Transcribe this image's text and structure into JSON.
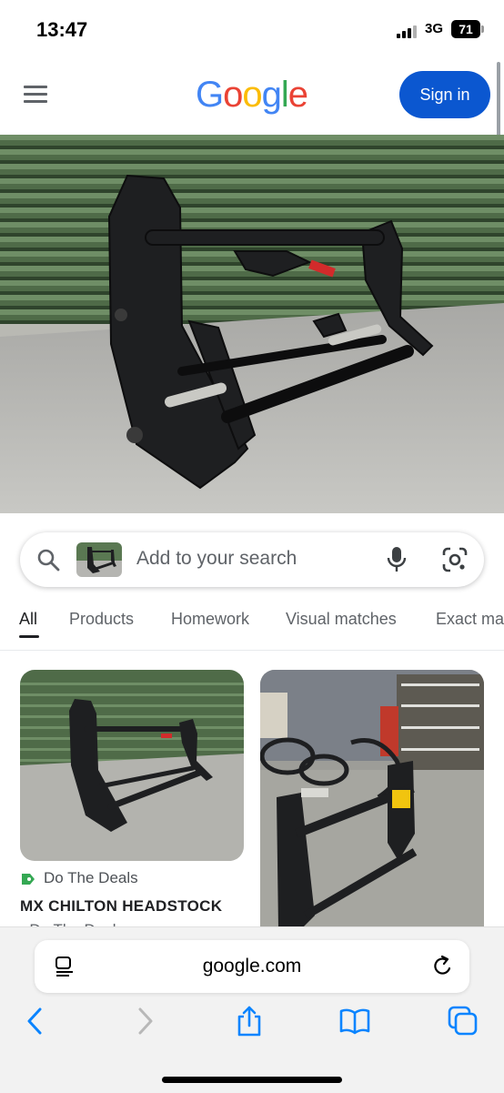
{
  "status_bar": {
    "time": "13:47",
    "network": "3G",
    "battery": "71"
  },
  "header": {
    "logo_letters": [
      {
        "char": "G",
        "color": "#4285F4"
      },
      {
        "char": "o",
        "color": "#EA4335"
      },
      {
        "char": "o",
        "color": "#FBBC05"
      },
      {
        "char": "g",
        "color": "#4285F4"
      },
      {
        "char": "l",
        "color": "#34A853"
      },
      {
        "char": "e",
        "color": "#EA4335"
      }
    ],
    "signin_label": "Sign in"
  },
  "search": {
    "placeholder": "Add to your search"
  },
  "tabs": [
    "All",
    "Products",
    "Homework",
    "Visual matches",
    "Exact ma"
  ],
  "results": [
    {
      "source": "Do The Deals",
      "title": "MX CHILTON HEADSTOCK",
      "title_line2": "- Do The Deals"
    }
  ],
  "browser": {
    "url": "google.com"
  },
  "icons": {
    "menu": "hamburger-menu-icon",
    "search": "magnifier-icon",
    "mic": "microphone-icon",
    "lens": "google-lens-icon",
    "back": "chevron-left-icon",
    "forward": "chevron-right-icon",
    "share": "share-icon",
    "bookmarks": "book-icon",
    "tabs": "tabs-icon"
  },
  "colors": {
    "accent": "#0b57d0",
    "ios_blue": "#0a84ff",
    "shopping_green": "#34a853"
  }
}
